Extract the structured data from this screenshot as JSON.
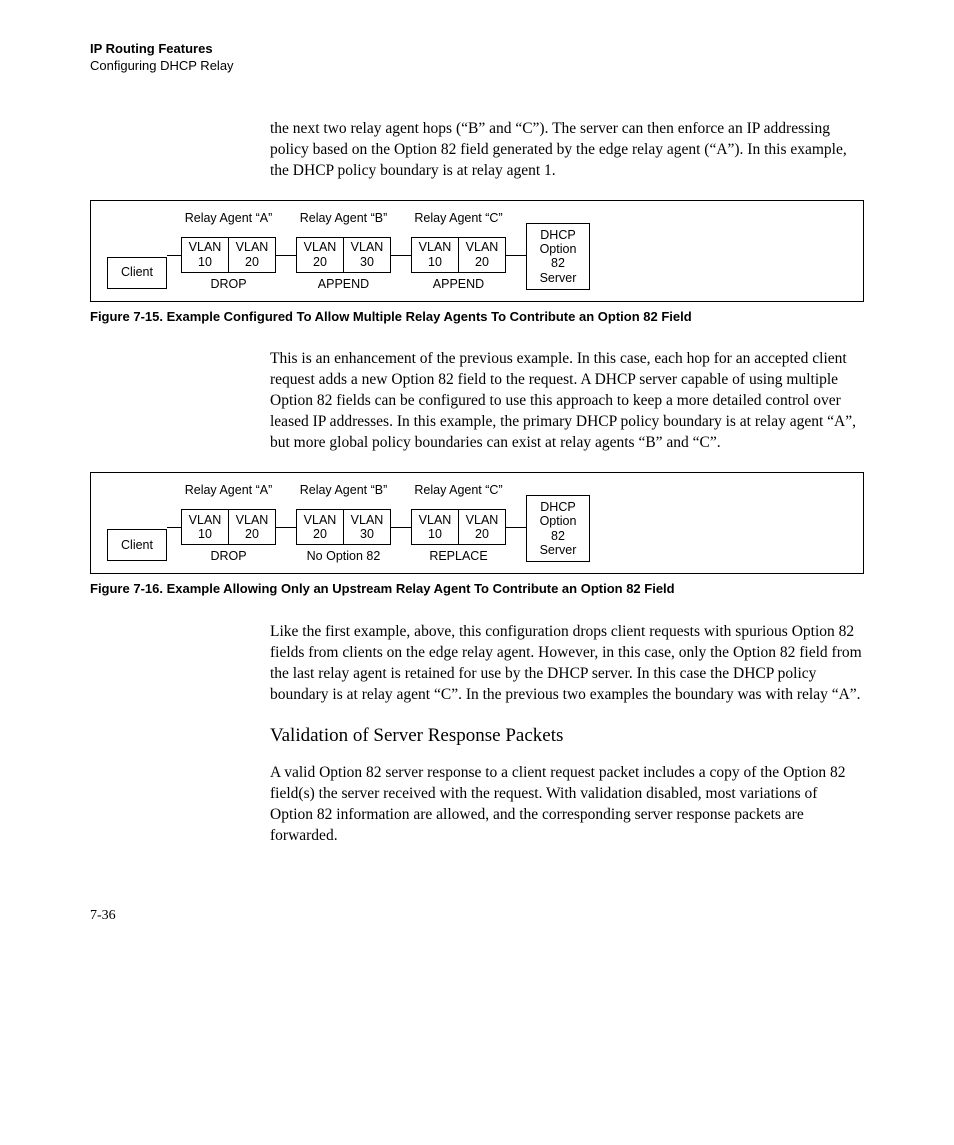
{
  "header": {
    "title": "IP Routing Features",
    "subtitle": "Configuring DHCP Relay"
  },
  "para1": "the next two relay agent hops (“B” and “C”).  The server can then enforce an IP addressing policy based on the Option 82 field generated by the edge relay agent (“A”). In this example,  the DHCP policy boundary is at relay agent 1.",
  "fig15": {
    "client": "Client",
    "server_l1": "DHCP",
    "server_l2": "Option",
    "server_l3": "82",
    "server_l4": "Server",
    "agents": [
      {
        "label": "Relay Agent “A”",
        "left_t": "VLAN",
        "left_b": "10",
        "right_t": "VLAN",
        "right_b": "20",
        "under": "DROP"
      },
      {
        "label": "Relay Agent “B”",
        "left_t": "VLAN",
        "left_b": "20",
        "right_t": "VLAN",
        "right_b": "30",
        "under": "APPEND"
      },
      {
        "label": "Relay Agent “C”",
        "left_t": "VLAN",
        "left_b": "10",
        "right_t": "VLAN",
        "right_b": "20",
        "under": "APPEND"
      }
    ],
    "caption": "Figure 7-15.  Example Configured To Allow Multiple Relay Agents To Contribute an Option 82 Field"
  },
  "para2": "This is an enhancement of the previous example.  In this case, each hop for an accepted client request adds a new Option 82 field to the request.  A DHCP server capable of using multiple Option 82 fields can be configured to use this approach to keep a more detailed control over leased IP addresses. In this example,  the primary DHCP policy boundary is at relay agent “A”, but more global policy boundaries can exist at relay agents “B” and “C”.",
  "fig16": {
    "client": "Client",
    "server_l1": "DHCP",
    "server_l2": "Option",
    "server_l3": "82",
    "server_l4": "Server",
    "agents": [
      {
        "label": "Relay Agent “A”",
        "left_t": "VLAN",
        "left_b": "10",
        "right_t": "VLAN",
        "right_b": "20",
        "under": "DROP"
      },
      {
        "label": "Relay Agent “B”",
        "left_t": "VLAN",
        "left_b": "20",
        "right_t": "VLAN",
        "right_b": "30",
        "under": "No Option 82"
      },
      {
        "label": "Relay Agent “C”",
        "left_t": "VLAN",
        "left_b": "10",
        "right_t": "VLAN",
        "right_b": "20",
        "under": "REPLACE"
      }
    ],
    "caption": "Figure 7-16.  Example Allowing Only an Upstream Relay Agent To Contribute an Option 82 Field"
  },
  "para3": "Like the first example, above, this configuration drops client requests with spurious Option 82 fields from clients on the edge relay agent. However, in this case, only the Option 82 field from the last relay agent  is retained for use by the DHCP server.  In this case the DHCP policy boundary is at relay agent “C”.  In the previous two examples the boundary was with relay “A”.",
  "heading": "Validation of Server Response Packets",
  "para4": "A valid Option 82 server response to a client request packet includes a copy of the Option 82 field(s) the server received with the request. With validation disabled, most variations of Option 82 information are allowed, and the corresponding server response packets are forwarded.",
  "page_num": "7-36"
}
